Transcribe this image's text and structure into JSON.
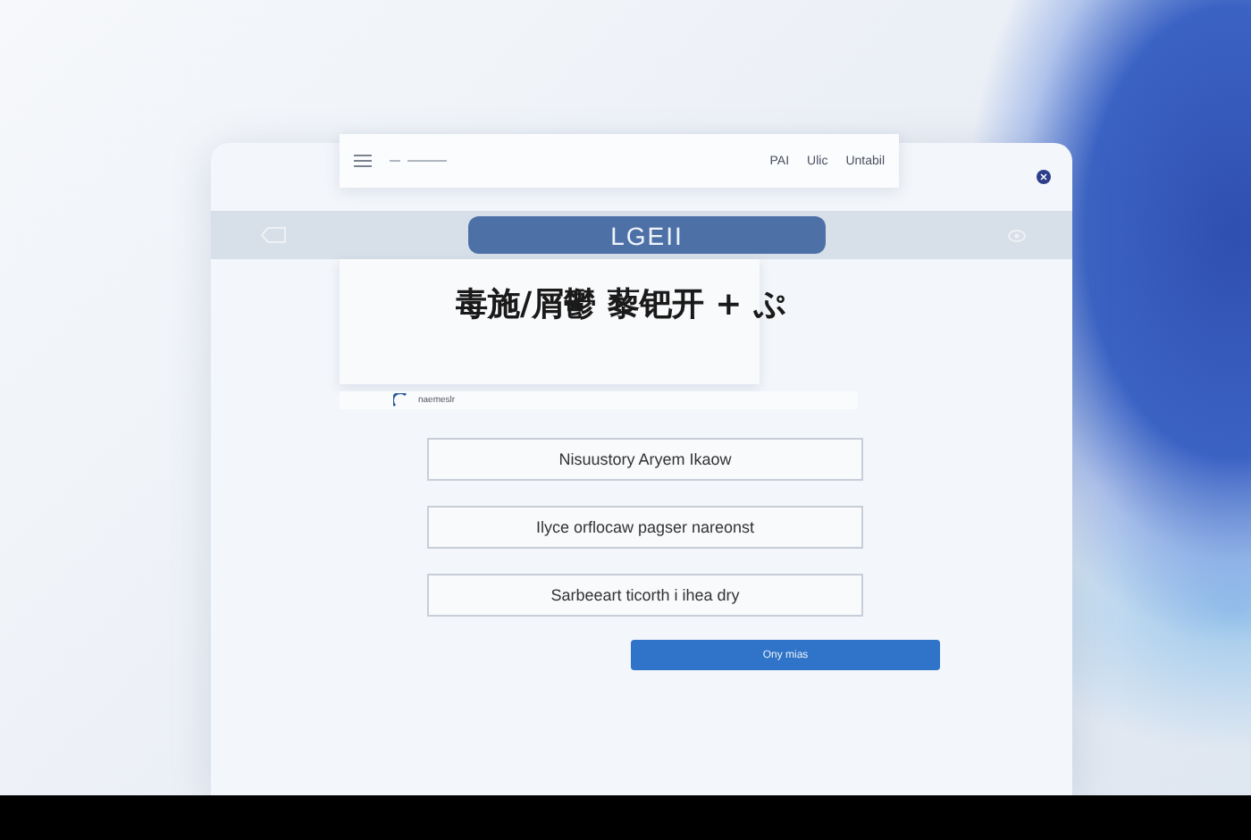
{
  "toolbar": {
    "items": [
      "PAI",
      "Ulic",
      "Untabil"
    ]
  },
  "header": {
    "title": "LGEII"
  },
  "heading": "毒施/屑鬱 藜钯开 + ぷ",
  "caption": "naemeslr",
  "fields": [
    {
      "value": "Nisuustory Aryem Ikaow"
    },
    {
      "value": "Ilyce orflocaw pagser nareonst"
    },
    {
      "value": "Sarbeeart ticorth i ihea dry"
    }
  ],
  "button": "Ony mias"
}
